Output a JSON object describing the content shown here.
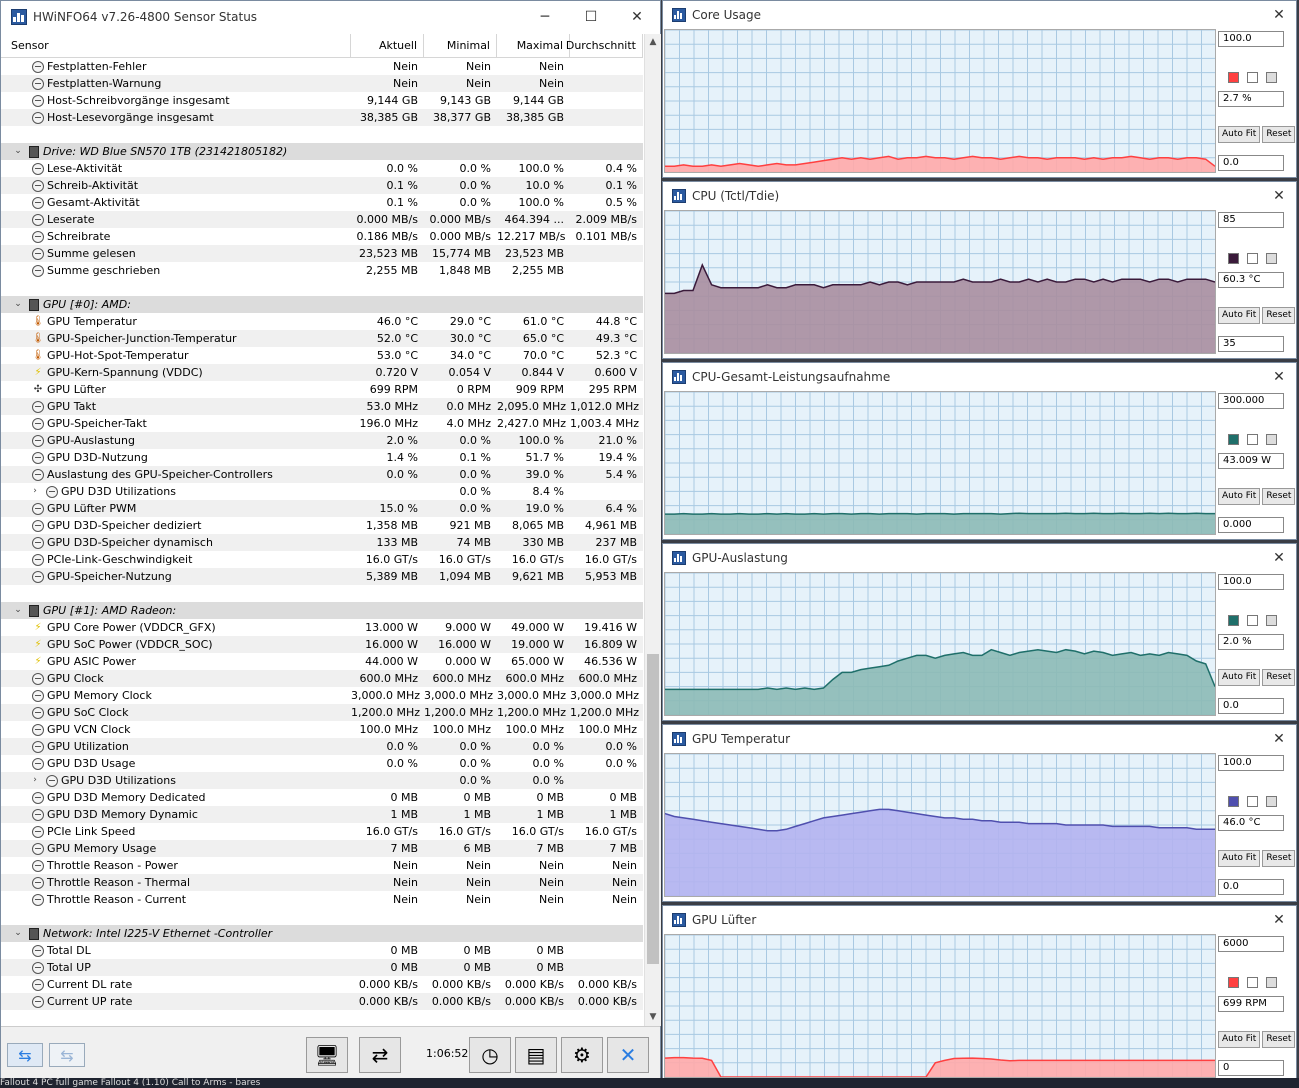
{
  "main": {
    "title": "HWiNFO64 v7.26-4800 Sensor Status",
    "win_min": "─",
    "win_max": "☐",
    "win_close": "✕",
    "columns": [
      "Sensor",
      "Aktuell",
      "Minimal",
      "Maximal",
      "Durchschnitt"
    ],
    "rows": [
      {
        "kind": "item",
        "icon": "circ",
        "name": "Festplatten-Fehler",
        "v": [
          "Nein",
          "Nein",
          "Nein",
          ""
        ]
      },
      {
        "kind": "item",
        "icon": "circ",
        "name": "Festplatten-Warnung",
        "v": [
          "Nein",
          "Nein",
          "Nein",
          ""
        ]
      },
      {
        "kind": "item",
        "icon": "circ",
        "name": "Host-Schreibvorgänge insgesamt",
        "v": [
          "9,144 GB",
          "9,143 GB",
          "9,144 GB",
          ""
        ]
      },
      {
        "kind": "item",
        "icon": "circ",
        "name": "Host-Lesevorgänge insgesamt",
        "v": [
          "38,385 GB",
          "38,377 GB",
          "38,385 GB",
          ""
        ]
      },
      {
        "kind": "blank"
      },
      {
        "kind": "group",
        "name": "Drive: WD Blue SN570 1TB (231421805182)"
      },
      {
        "kind": "item",
        "icon": "circ",
        "name": "Lese-Aktivität",
        "v": [
          "0.0 %",
          "0.0 %",
          "100.0 %",
          "0.4 %"
        ]
      },
      {
        "kind": "item",
        "icon": "circ",
        "name": "Schreib-Aktivität",
        "v": [
          "0.1 %",
          "0.0 %",
          "10.0 %",
          "0.1 %"
        ]
      },
      {
        "kind": "item",
        "icon": "circ",
        "name": "Gesamt-Aktivität",
        "v": [
          "0.1 %",
          "0.0 %",
          "100.0 %",
          "0.5 %"
        ]
      },
      {
        "kind": "item",
        "icon": "circ",
        "name": "Leserate",
        "v": [
          "0.000 MB/s",
          "0.000 MB/s",
          "464.394 ...",
          "2.009 MB/s"
        ]
      },
      {
        "kind": "item",
        "icon": "circ",
        "name": "Schreibrate",
        "v": [
          "0.186 MB/s",
          "0.000 MB/s",
          "12.217 MB/s",
          "0.101 MB/s"
        ]
      },
      {
        "kind": "item",
        "icon": "circ",
        "name": "Summe gelesen",
        "v": [
          "23,523 MB",
          "15,774 MB",
          "23,523 MB",
          ""
        ]
      },
      {
        "kind": "item",
        "icon": "circ",
        "name": "Summe geschrieben",
        "v": [
          "2,255 MB",
          "1,848 MB",
          "2,255 MB",
          ""
        ]
      },
      {
        "kind": "blank"
      },
      {
        "kind": "group",
        "name": "GPU [#0]: AMD:"
      },
      {
        "kind": "item",
        "icon": "therm",
        "name": "GPU Temperatur",
        "v": [
          "46.0 °C",
          "29.0 °C",
          "61.0 °C",
          "44.8 °C"
        ]
      },
      {
        "kind": "item",
        "icon": "therm",
        "name": "GPU-Speicher-Junction-Temperatur",
        "v": [
          "52.0 °C",
          "30.0 °C",
          "65.0 °C",
          "49.3 °C"
        ]
      },
      {
        "kind": "item",
        "icon": "therm",
        "name": "GPU-Hot-Spot-Temperatur",
        "v": [
          "53.0 °C",
          "34.0 °C",
          "70.0 °C",
          "52.3 °C"
        ]
      },
      {
        "kind": "item",
        "icon": "bolt",
        "name": "GPU-Kern-Spannung (VDDC)",
        "v": [
          "0.720 V",
          "0.054 V",
          "0.844 V",
          "0.600 V"
        ]
      },
      {
        "kind": "item",
        "icon": "fan",
        "name": "GPU Lüfter",
        "v": [
          "699 RPM",
          "0 RPM",
          "909 RPM",
          "295 RPM"
        ]
      },
      {
        "kind": "item",
        "icon": "circ",
        "name": "GPU Takt",
        "v": [
          "53.0 MHz",
          "0.0 MHz",
          "2,095.0 MHz",
          "1,012.0 MHz"
        ]
      },
      {
        "kind": "item",
        "icon": "circ",
        "name": "GPU-Speicher-Takt",
        "v": [
          "196.0 MHz",
          "4.0 MHz",
          "2,427.0 MHz",
          "1,003.4 MHz"
        ]
      },
      {
        "kind": "item",
        "icon": "circ",
        "name": "GPU-Auslastung",
        "v": [
          "2.0 %",
          "0.0 %",
          "100.0 %",
          "21.0 %"
        ]
      },
      {
        "kind": "item",
        "icon": "circ",
        "name": "GPU D3D-Nutzung",
        "v": [
          "1.4 %",
          "0.1 %",
          "51.7 %",
          "19.4 %"
        ]
      },
      {
        "kind": "item",
        "icon": "circ",
        "name": "Auslastung des GPU-Speicher-Controllers",
        "v": [
          "0.0 %",
          "0.0 %",
          "39.0 %",
          "5.4 %"
        ]
      },
      {
        "kind": "sub",
        "icon": "circ",
        "name": "GPU D3D Utilizations",
        "v": [
          "",
          "0.0 %",
          "8.4 %",
          ""
        ]
      },
      {
        "kind": "item",
        "icon": "circ",
        "name": "GPU Lüfter PWM",
        "v": [
          "15.0 %",
          "0.0 %",
          "19.0 %",
          "6.4 %"
        ]
      },
      {
        "kind": "item",
        "icon": "circ",
        "name": "GPU D3D-Speicher dediziert",
        "v": [
          "1,358 MB",
          "921 MB",
          "8,065 MB",
          "4,961 MB"
        ]
      },
      {
        "kind": "item",
        "icon": "circ",
        "name": "GPU D3D-Speicher dynamisch",
        "v": [
          "133 MB",
          "74 MB",
          "330 MB",
          "237 MB"
        ]
      },
      {
        "kind": "item",
        "icon": "circ",
        "name": "PCIe-Link-Geschwindigkeit",
        "v": [
          "16.0 GT/s",
          "16.0 GT/s",
          "16.0 GT/s",
          "16.0 GT/s"
        ]
      },
      {
        "kind": "item",
        "icon": "circ",
        "name": "GPU-Speicher-Nutzung",
        "v": [
          "5,389 MB",
          "1,094 MB",
          "9,621 MB",
          "5,953 MB"
        ]
      },
      {
        "kind": "blank"
      },
      {
        "kind": "group",
        "name": "GPU [#1]: AMD Radeon:"
      },
      {
        "kind": "item",
        "icon": "bolt",
        "name": "GPU Core Power (VDDCR_GFX)",
        "v": [
          "13.000 W",
          "9.000 W",
          "49.000 W",
          "19.416 W"
        ]
      },
      {
        "kind": "item",
        "icon": "bolt",
        "name": "GPU SoC Power (VDDCR_SOC)",
        "v": [
          "16.000 W",
          "16.000 W",
          "19.000 W",
          "16.809 W"
        ]
      },
      {
        "kind": "item",
        "icon": "bolt",
        "name": "GPU ASIC Power",
        "v": [
          "44.000 W",
          "0.000 W",
          "65.000 W",
          "46.536 W"
        ]
      },
      {
        "kind": "item",
        "icon": "circ",
        "name": "GPU Clock",
        "v": [
          "600.0 MHz",
          "600.0 MHz",
          "600.0 MHz",
          "600.0 MHz"
        ]
      },
      {
        "kind": "item",
        "icon": "circ",
        "name": "GPU Memory Clock",
        "v": [
          "3,000.0 MHz",
          "3,000.0 MHz",
          "3,000.0 MHz",
          "3,000.0 MHz"
        ]
      },
      {
        "kind": "item",
        "icon": "circ",
        "name": "GPU SoC Clock",
        "v": [
          "1,200.0 MHz",
          "1,200.0 MHz",
          "1,200.0 MHz",
          "1,200.0 MHz"
        ]
      },
      {
        "kind": "item",
        "icon": "circ",
        "name": "GPU VCN Clock",
        "v": [
          "100.0 MHz",
          "100.0 MHz",
          "100.0 MHz",
          "100.0 MHz"
        ]
      },
      {
        "kind": "item",
        "icon": "circ",
        "name": "GPU Utilization",
        "v": [
          "0.0 %",
          "0.0 %",
          "0.0 %",
          "0.0 %"
        ]
      },
      {
        "kind": "item",
        "icon": "circ",
        "name": "GPU D3D Usage",
        "v": [
          "0.0 %",
          "0.0 %",
          "0.0 %",
          "0.0 %"
        ]
      },
      {
        "kind": "sub",
        "icon": "circ",
        "name": "GPU D3D Utilizations",
        "v": [
          "",
          "0.0 %",
          "0.0 %",
          ""
        ]
      },
      {
        "kind": "item",
        "icon": "circ",
        "name": "GPU D3D Memory Dedicated",
        "v": [
          "0 MB",
          "0 MB",
          "0 MB",
          "0 MB"
        ]
      },
      {
        "kind": "item",
        "icon": "circ",
        "name": "GPU D3D Memory Dynamic",
        "v": [
          "1 MB",
          "1 MB",
          "1 MB",
          "1 MB"
        ]
      },
      {
        "kind": "item",
        "icon": "circ",
        "name": "PCIe Link Speed",
        "v": [
          "16.0 GT/s",
          "16.0 GT/s",
          "16.0 GT/s",
          "16.0 GT/s"
        ]
      },
      {
        "kind": "item",
        "icon": "circ",
        "name": "GPU Memory Usage",
        "v": [
          "7 MB",
          "6 MB",
          "7 MB",
          "7 MB"
        ]
      },
      {
        "kind": "item",
        "icon": "circ",
        "name": "Throttle Reason - Power",
        "v": [
          "Nein",
          "Nein",
          "Nein",
          "Nein"
        ]
      },
      {
        "kind": "item",
        "icon": "circ",
        "name": "Throttle Reason - Thermal",
        "v": [
          "Nein",
          "Nein",
          "Nein",
          "Nein"
        ]
      },
      {
        "kind": "item",
        "icon": "circ",
        "name": "Throttle Reason - Current",
        "v": [
          "Nein",
          "Nein",
          "Nein",
          "Nein"
        ]
      },
      {
        "kind": "blank"
      },
      {
        "kind": "group",
        "name": "Network: Intel I225-V Ethernet -Controller"
      },
      {
        "kind": "item",
        "icon": "circ",
        "name": "Total DL",
        "v": [
          "0 MB",
          "0 MB",
          "0 MB",
          ""
        ]
      },
      {
        "kind": "item",
        "icon": "circ",
        "name": "Total UP",
        "v": [
          "0 MB",
          "0 MB",
          "0 MB",
          ""
        ]
      },
      {
        "kind": "item",
        "icon": "circ",
        "name": "Current DL rate",
        "v": [
          "0.000 KB/s",
          "0.000 KB/s",
          "0.000 KB/s",
          "0.000 KB/s"
        ]
      },
      {
        "kind": "item",
        "icon": "circ",
        "name": "Current UP rate",
        "v": [
          "0.000 KB/s",
          "0.000 KB/s",
          "0.000 KB/s",
          "0.000 KB/s"
        ]
      }
    ],
    "toolbar": {
      "timer": "1:06:52",
      "icons": [
        "nav-forward-icon",
        "nav-back-icon",
        "network-icon",
        "sync-icon",
        "clock-icon",
        "report-icon",
        "settings-icon",
        "close-icon"
      ]
    }
  },
  "graphs": [
    {
      "title": "Core Usage",
      "max": "100.0",
      "current": "2.7 %",
      "min": "0.0",
      "color": "#ff4040",
      "fill": "#ffaaaa",
      "values": [
        4,
        4,
        5,
        4,
        4,
        5,
        4,
        5,
        6,
        5,
        4,
        5,
        6,
        5,
        5,
        6,
        7,
        8,
        9,
        10,
        9,
        10,
        9,
        10,
        11,
        9,
        10,
        10,
        11,
        10,
        10,
        9,
        10,
        11,
        10,
        10,
        9,
        10,
        11,
        10,
        10,
        9,
        10,
        10,
        10,
        9,
        10,
        9,
        10,
        10,
        11,
        10,
        9,
        10,
        10,
        9,
        10,
        10,
        9,
        4
      ]
    },
    {
      "title": "CPU (Tctl/Tdie)",
      "max": "85",
      "current": "60.3 °C",
      "min": "35",
      "color": "#3a1a3a",
      "fill": "#a88ea0",
      "values": [
        56,
        56,
        57,
        57,
        66,
        59,
        58,
        58,
        58,
        58,
        58,
        59,
        58,
        58,
        59,
        59,
        59,
        58,
        59,
        59,
        59,
        59,
        60,
        59,
        60,
        60,
        59,
        60,
        60,
        60,
        60,
        60,
        61,
        60,
        60,
        60,
        61,
        60,
        60,
        61,
        60,
        61,
        60,
        60,
        61,
        61,
        60,
        61,
        60,
        61,
        61,
        61,
        60,
        61,
        61,
        60,
        61,
        61,
        61,
        60
      ]
    },
    {
      "title": "CPU-Gesamt-Leistungsaufnahme",
      "max": "300.000",
      "current": "43.009 W",
      "min": "0.000",
      "color": "#1f6f6a",
      "fill": "#8cbab6",
      "values": [
        42,
        42,
        43,
        42,
        42,
        43,
        42,
        42,
        43,
        42,
        42,
        43,
        42,
        43,
        42,
        42,
        43,
        42,
        43,
        43,
        42,
        43,
        43,
        42,
        43,
        43,
        43,
        42,
        43,
        43,
        43,
        42,
        43,
        43,
        43,
        43,
        42,
        43,
        44,
        43,
        43,
        43,
        43,
        44,
        43,
        43,
        44,
        43,
        43,
        44,
        43,
        43,
        44,
        43,
        44,
        43,
        43,
        44,
        43,
        43
      ]
    },
    {
      "title": "GPU-Auslastung",
      "max": "100.0",
      "current": "2.0 %",
      "min": "0.0",
      "color": "#1f6f6a",
      "fill": "#8cbab6",
      "values": [
        18,
        18,
        18,
        18,
        18,
        18,
        18,
        18,
        18,
        18,
        18,
        19,
        18,
        19,
        18,
        19,
        18,
        19,
        25,
        30,
        30,
        32,
        33,
        34,
        35,
        38,
        40,
        42,
        42,
        40,
        42,
        43,
        44,
        42,
        42,
        46,
        44,
        42,
        44,
        45,
        46,
        45,
        44,
        46,
        45,
        43,
        45,
        44,
        42,
        43,
        44,
        42,
        43,
        42,
        44,
        43,
        42,
        38,
        36,
        20
      ]
    },
    {
      "title": "GPU Temperatur",
      "max": "100.0",
      "current": "46.0 °C",
      "min": "0.0",
      "color": "#4f4fae",
      "fill": "#b3b3ef",
      "values": [
        58,
        56,
        55,
        54,
        53,
        52,
        51,
        50,
        49,
        48,
        47,
        46,
        46,
        47,
        49,
        51,
        53,
        55,
        56,
        57,
        58,
        59,
        60,
        61,
        61,
        60,
        59,
        58,
        57,
        56,
        55,
        55,
        54,
        54,
        53,
        53,
        52,
        52,
        52,
        51,
        51,
        51,
        51,
        50,
        50,
        50,
        50,
        50,
        49,
        49,
        49,
        49,
        49,
        48,
        48,
        48,
        48,
        47,
        47,
        47
      ]
    },
    {
      "title": "GPU Lüfter",
      "max": "6000",
      "current": "699 RPM",
      "min": "0",
      "color": "#ff4040",
      "fill": "#ffaaaa",
      "values": [
        800,
        820,
        820,
        800,
        790,
        700,
        0,
        0,
        0,
        0,
        0,
        0,
        0,
        0,
        0,
        0,
        0,
        0,
        0,
        0,
        0,
        0,
        0,
        0,
        0,
        0,
        0,
        0,
        0,
        600,
        700,
        780,
        790,
        800,
        780,
        760,
        720,
        690,
        700,
        700,
        700,
        700,
        700,
        700,
        700,
        700,
        700,
        700,
        700,
        700,
        700,
        700,
        700,
        700,
        700,
        700,
        700,
        700,
        700,
        700
      ]
    }
  ],
  "graph_buttons": {
    "autofit": "Auto Fit",
    "reset": "Reset"
  },
  "taskbar": "Fallout 4 PC full game     Fallout 4 (1.10)     Call to Arms - bares"
}
